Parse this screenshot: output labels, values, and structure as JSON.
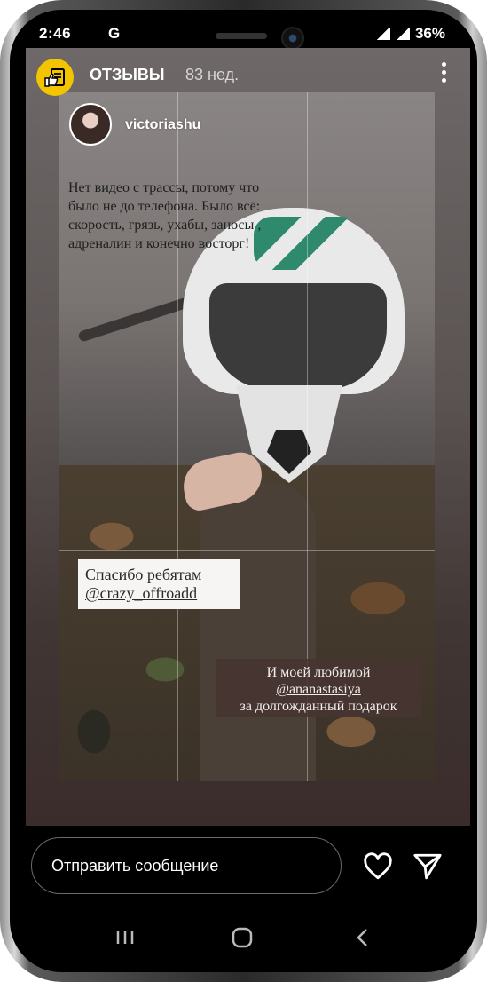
{
  "status_bar": {
    "time": "2:46",
    "carrier_icon": "G",
    "battery": "36%"
  },
  "story_header": {
    "title": "ОТЗЫВЫ",
    "age": "83 нед."
  },
  "story": {
    "username": "victoriashu",
    "caption": "Нет видео с трассы, потому что было не до телефона. Было всё: скорость, грязь, ухабы, заносы , адреналин и конечно восторг!",
    "sticker1": {
      "line1": "Спасибо ребятам",
      "mention": "@crazy_offroadd"
    },
    "sticker2": {
      "line1": "И моей любимой",
      "mention": "@ananastasiya",
      "line3": "за долгожданный подарок"
    }
  },
  "reply": {
    "placeholder": "Отправить сообщение"
  },
  "icons": {
    "like": "heart-icon",
    "share": "send-icon",
    "more": "more-vertical-icon",
    "highlight": "thumbs-up-document-icon"
  },
  "colors": {
    "accent": "#f3c400",
    "background": "#000000"
  }
}
